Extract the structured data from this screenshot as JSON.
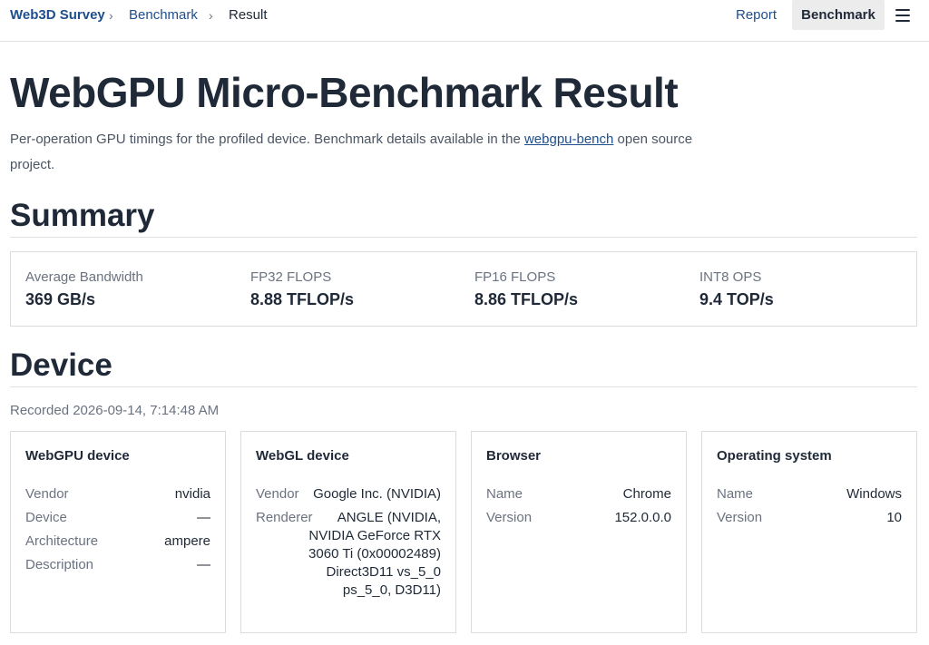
{
  "breadcrumb": {
    "home": "Web3D Survey",
    "section": "Benchmark",
    "current": "Result",
    "separator": "›"
  },
  "nav": {
    "report": "Report",
    "benchmark": "Benchmark",
    "menu_icon": "hamburger-menu-icon"
  },
  "page": {
    "title": "WebGPU Micro-Benchmark Result",
    "intro_before": "Per-operation GPU timings for the profiled device. Benchmark details available in the ",
    "intro_link": "webgpu-bench",
    "intro_after": " open source project."
  },
  "summary": {
    "heading": "Summary",
    "stats": [
      {
        "label": "Average Bandwidth",
        "value": "369 GB/s"
      },
      {
        "label": "FP32 FLOPS",
        "value": "8.88 TFLOP/s"
      },
      {
        "label": "FP16 FLOPS",
        "value": "8.86 TFLOP/s"
      },
      {
        "label": "INT8 OPS",
        "value": "9.4 TOP/s"
      }
    ]
  },
  "device": {
    "heading": "Device",
    "recorded": "Recorded 2026-09-14, 7:14:48 AM",
    "cards": [
      {
        "title": "WebGPU device",
        "rows": [
          {
            "key": "Vendor",
            "value": "nvidia"
          },
          {
            "key": "Device",
            "value": "—"
          },
          {
            "key": "Architecture",
            "value": "ampere"
          },
          {
            "key": "Description",
            "value": "—"
          }
        ]
      },
      {
        "title": "WebGL device",
        "rows": [
          {
            "key": "Vendor",
            "value": "Google Inc. (NVIDIA)"
          },
          {
            "key": "Renderer",
            "value": "ANGLE (NVIDIA, NVIDIA GeForce RTX 3060 Ti (0x00002489) Direct3D11 vs_5_0 ps_5_0, D3D11)"
          }
        ]
      },
      {
        "title": "Browser",
        "rows": [
          {
            "key": "Name",
            "value": "Chrome"
          },
          {
            "key": "Version",
            "value": "152.0.0.0"
          }
        ]
      },
      {
        "title": "Operating system",
        "rows": [
          {
            "key": "Name",
            "value": "Windows"
          },
          {
            "key": "Version",
            "value": "10"
          }
        ]
      }
    ]
  }
}
